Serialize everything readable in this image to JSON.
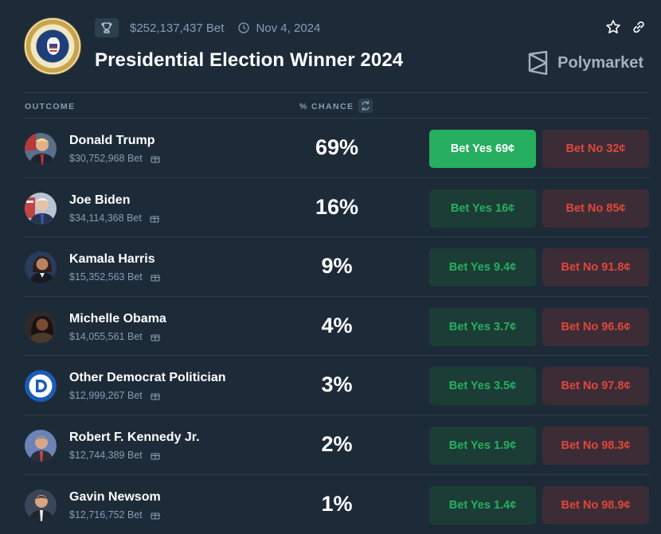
{
  "header": {
    "volume": "$252,137,437 Bet",
    "date": "Nov 4, 2024",
    "title": "Presidential Election Winner 2024",
    "brand": "Polymarket"
  },
  "table": {
    "col_outcome": "OUTCOME",
    "col_chance": "% CHANCE"
  },
  "outcomes": [
    {
      "name": "Donald Trump",
      "volume": "$30,752,968 Bet",
      "chance": "69%",
      "yes": "Bet Yes 69¢",
      "no": "Bet No 32¢"
    },
    {
      "name": "Joe Biden",
      "volume": "$34,114,368 Bet",
      "chance": "16%",
      "yes": "Bet Yes 16¢",
      "no": "Bet No 85¢"
    },
    {
      "name": "Kamala Harris",
      "volume": "$15,352,563 Bet",
      "chance": "9%",
      "yes": "Bet Yes 9.4¢",
      "no": "Bet No 91.8¢"
    },
    {
      "name": "Michelle Obama",
      "volume": "$14,055,561 Bet",
      "chance": "4%",
      "yes": "Bet Yes 3.7¢",
      "no": "Bet No 96.6¢"
    },
    {
      "name": "Other Democrat Politician",
      "volume": "$12,999,267 Bet",
      "chance": "3%",
      "yes": "Bet Yes 3.5¢",
      "no": "Bet No 97.8¢"
    },
    {
      "name": "Robert F. Kennedy Jr.",
      "volume": "$12,744,389 Bet",
      "chance": "2%",
      "yes": "Bet Yes 1.9¢",
      "no": "Bet No 98.3¢"
    },
    {
      "name": "Gavin Newsom",
      "volume": "$12,716,752 Bet",
      "chance": "1%",
      "yes": "Bet Yes 1.4¢",
      "no": "Bet No 98.9¢"
    }
  ],
  "colors": {
    "background": "#1d2b39",
    "yes_green": "#27ae60",
    "no_red": "#e0473b",
    "muted_text": "#899cb2"
  },
  "icons": [
    "presidential-seal",
    "trophy-icon",
    "clock-icon",
    "star-icon",
    "link-icon",
    "polymarket-logo",
    "refresh-icon",
    "gift-icon",
    "democrat-logo"
  ]
}
